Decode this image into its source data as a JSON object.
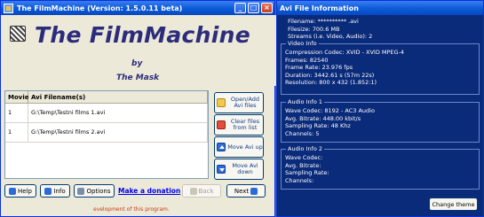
{
  "main_window": {
    "title": "The FilmMachine   (Version: 1.5.0.11 beta)",
    "title_buttons": [
      "_",
      "□",
      "×"
    ],
    "logo": {
      "title": "The FilmMachine",
      "by": "by",
      "author": "The Mask"
    },
    "grid": {
      "headers": {
        "movie": "Movie",
        "file": "Avi Filename(s)"
      },
      "rows": [
        {
          "movie": "1",
          "file": "G:\\Temp\\Testni films 1.avi"
        },
        {
          "movie": "1",
          "file": "G:\\Temp\\Testni films 2.avi"
        }
      ]
    },
    "side_buttons": {
      "open": "Open/Add Avi files",
      "clear": "Clear files from list",
      "up": "Move Avi up",
      "down": "Move Avi down"
    },
    "bottom": {
      "help": "Help",
      "info": "Info",
      "options": "Options",
      "donate": "Make a donation",
      "back": "Back",
      "next": "Next"
    },
    "footer": "evelopment of this program."
  },
  "info_window": {
    "title": "Avi File Information",
    "top": {
      "filename": "Filename: ********** .avi",
      "filesize": "Filesize: 700.6 MB",
      "streams": "Streams (i.e. Video, Audio): 2"
    },
    "video": {
      "title": "Video Info",
      "lines": [
        "Compression Codec: XVID - XVID MPEG-4",
        "Frames: 82540",
        "Frame Rate: 23.976 fps",
        "Duration: 3442.61 s (57m 22s)",
        "Resolution: 800 x 432  (1.852:1)"
      ]
    },
    "audio1": {
      "title": "Audio Info 1",
      "lines": [
        "Wave Codec: 8192 - AC3 Audio",
        "Avg. Bitrate: 448.00 kbit/s",
        "Sampling Rate: 48 Khz",
        "Channels: 5"
      ]
    },
    "audio2": {
      "title": "Audio Info 2",
      "lines": [
        "Wave Codec:",
        "Avg. Bitrate:",
        "Sampling Rate:",
        "Channels:"
      ]
    },
    "change_theme": "Change theme"
  }
}
